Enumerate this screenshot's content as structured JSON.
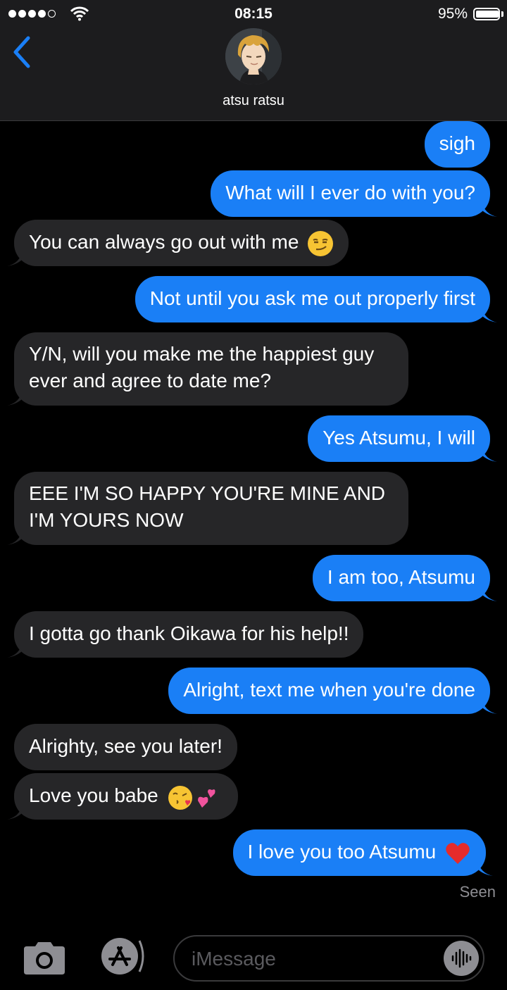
{
  "status_bar": {
    "time": "08:15",
    "battery": "95%",
    "battery_level": 0.95
  },
  "header": {
    "contact_name": "atsu ratsu"
  },
  "messages": [
    {
      "dir": "out",
      "text": "sigh"
    },
    {
      "dir": "out",
      "text": "What will I ever do with you?"
    },
    {
      "dir": "in",
      "text": "You can always go out with me",
      "emoji": "smirk"
    },
    {
      "dir": "out",
      "text": "Not until you ask me out properly first"
    },
    {
      "dir": "in",
      "text": "Y/N, will you make me the happiest guy ever and agree to date me?"
    },
    {
      "dir": "out",
      "text": "Yes Atsumu, I will"
    },
    {
      "dir": "in",
      "text": "EEE I'M SO HAPPY YOU'RE MINE AND I'M YOURS NOW"
    },
    {
      "dir": "out",
      "text": "I am too, Atsumu"
    },
    {
      "dir": "in",
      "text": "I gotta go thank Oikawa for his help!!"
    },
    {
      "dir": "out",
      "text": "Alright, text me when you're done"
    },
    {
      "dir": "in",
      "text": "Alrighty, see you later!"
    },
    {
      "dir": "in",
      "text": "Love you babe",
      "emoji": "kiss-hearts"
    },
    {
      "dir": "out",
      "text": "I love you too Atsumu",
      "emoji": "red-heart"
    }
  ],
  "seen_label": "Seen",
  "input": {
    "placeholder": "iMessage"
  },
  "colors": {
    "outgoing": "#1a7ff6",
    "incoming": "#262628",
    "background": "#000000",
    "header": "#1c1c1e",
    "back_arrow": "#1a7ff6"
  },
  "icons": [
    "back-chevron-icon",
    "wifi-icon",
    "camera-icon",
    "app-store-icon",
    "voice-waveform-icon"
  ]
}
